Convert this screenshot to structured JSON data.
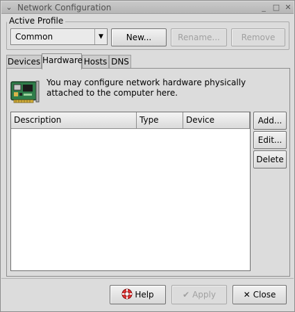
{
  "window": {
    "title": "Network Configuration",
    "menu_glyph": "⌄",
    "minimize_glyph": "_",
    "maximize_glyph": "□",
    "close_glyph": "✕"
  },
  "profile": {
    "label": "Active Profile",
    "selected": "Common",
    "new_label": "New...",
    "rename_label": "Rename...",
    "remove_label": "Remove"
  },
  "tabs": [
    {
      "label": "Devices"
    },
    {
      "label": "Hardware"
    },
    {
      "label": "Hosts"
    },
    {
      "label": "DNS"
    }
  ],
  "hardware": {
    "info_line1": "You may configure network hardware physically",
    "info_line2": "attached to the computer here.",
    "columns": [
      "Description",
      "Type",
      "Device"
    ],
    "add_label": "Add...",
    "edit_label": "Edit...",
    "delete_label": "Delete"
  },
  "footer": {
    "help_label": "Help",
    "apply_label": "Apply",
    "close_label": "Close"
  },
  "colors": {
    "background": "#dcdcdc",
    "list_background": "#ffffff",
    "disabled_text": "#a0a0a0"
  }
}
